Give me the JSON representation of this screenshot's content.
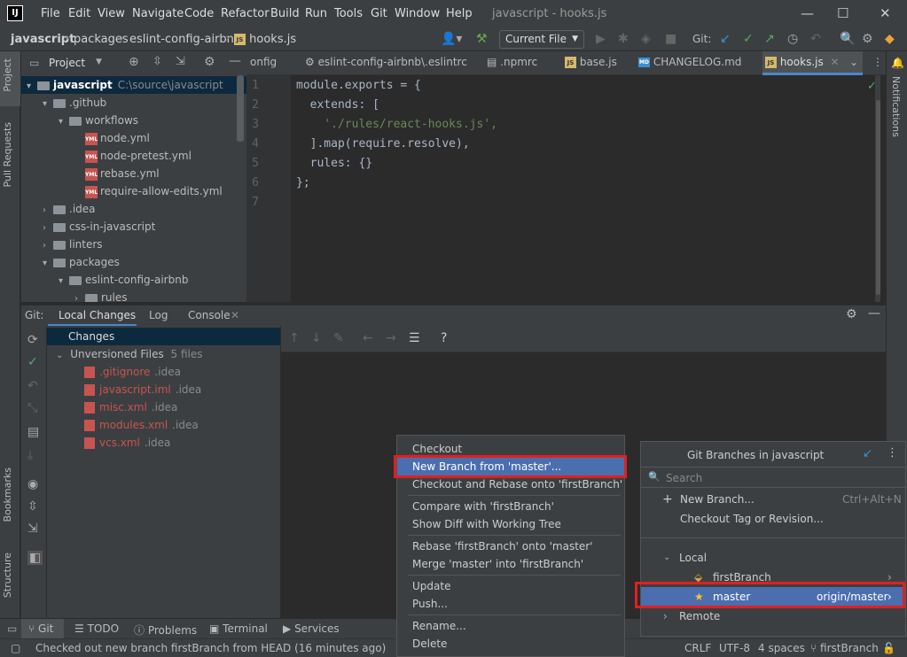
{
  "app": {
    "window_title": "javascript - hooks.js",
    "logo": "IJ"
  },
  "menu": [
    "File",
    "Edit",
    "View",
    "Navigate",
    "Code",
    "Refactor",
    "Build",
    "Run",
    "Tools",
    "Git",
    "Window",
    "Help"
  ],
  "breadcrumb": [
    "javascript",
    "packages",
    "eslint-config-airbnb",
    "hooks.js"
  ],
  "toolbar": {
    "run_config": "Current File",
    "git_label": "Git:"
  },
  "left_tools": {
    "project": "Project",
    "pull_requests": "Pull Requests",
    "bookmarks": "Bookmarks",
    "structure": "Structure"
  },
  "right_tools": {
    "notifications": "Notifications"
  },
  "project": {
    "header": "Project",
    "tree": [
      {
        "label": "javascript",
        "hint": "C:\\source\\javascript",
        "indent": 0,
        "arrow": "▾",
        "kind": "folder",
        "selected": true
      },
      {
        "label": ".github",
        "indent": 1,
        "arrow": "▾",
        "kind": "folder"
      },
      {
        "label": "workflows",
        "indent": 2,
        "arrow": "▾",
        "kind": "folder"
      },
      {
        "label": "node.yml",
        "indent": 3,
        "arrow": "",
        "kind": "yml"
      },
      {
        "label": "node-pretest.yml",
        "indent": 3,
        "arrow": "",
        "kind": "yml"
      },
      {
        "label": "rebase.yml",
        "indent": 3,
        "arrow": "",
        "kind": "yml"
      },
      {
        "label": "require-allow-edits.yml",
        "indent": 3,
        "arrow": "",
        "kind": "yml"
      },
      {
        "label": ".idea",
        "indent": 1,
        "arrow": "›",
        "kind": "folder"
      },
      {
        "label": "css-in-javascript",
        "indent": 1,
        "arrow": "›",
        "kind": "folder"
      },
      {
        "label": "linters",
        "indent": 1,
        "arrow": "›",
        "kind": "folder"
      },
      {
        "label": "packages",
        "indent": 1,
        "arrow": "▾",
        "kind": "folder"
      },
      {
        "label": "eslint-config-airbnb",
        "indent": 2,
        "arrow": "▾",
        "kind": "folder"
      },
      {
        "label": "rules",
        "indent": 3,
        "arrow": "›",
        "kind": "folder"
      }
    ]
  },
  "editor_tabs": [
    "onfig",
    "eslint-config-airbnb\\.eslintrc",
    ".npmrc",
    "base.js",
    "CHANGELOG.md",
    "hooks.js"
  ],
  "editor": {
    "lines": [
      "module.exports = {",
      "  extends: [",
      "    './rules/react-hooks.js',",
      "  ].map(require.resolve),",
      "  rules: {}",
      "};",
      ""
    ],
    "line_numbers": [
      "1",
      "2",
      "3",
      "4",
      "5",
      "6",
      "7"
    ]
  },
  "git_window": {
    "label": "Git:",
    "tabs": [
      "Local Changes",
      "Log",
      "Console"
    ],
    "changes_header": "Changes",
    "unversioned": "Unversioned Files",
    "unversioned_count": "5 files",
    "files": [
      {
        "name": ".gitignore",
        "dir": ".idea"
      },
      {
        "name": "javascript.iml",
        "dir": ".idea"
      },
      {
        "name": "misc.xml",
        "dir": ".idea"
      },
      {
        "name": "modules.xml",
        "dir": ".idea"
      },
      {
        "name": "vcs.xml",
        "dir": ".idea"
      }
    ]
  },
  "bottom_tabs": [
    "Git",
    "TODO",
    "Problems",
    "Terminal",
    "Services"
  ],
  "status": {
    "message": "Checked out new branch firstBranch from HEAD (16 minutes ago)",
    "line_sep": "CRLF",
    "encoding": "UTF-8",
    "indent": "4 spaces",
    "branch": "firstBranch"
  },
  "context_menu": {
    "groups": [
      [
        "Checkout",
        "New Branch from 'master'...",
        "Checkout and Rebase onto 'firstBranch'"
      ],
      [
        "Compare with 'firstBranch'",
        "Show Diff with Working Tree"
      ],
      [
        "Rebase 'firstBranch' onto 'master'",
        "Merge 'master' into 'firstBranch'"
      ],
      [
        "Update",
        "Push..."
      ],
      [
        "Rename...",
        "Delete"
      ]
    ],
    "highlighted": "New Branch from 'master'..."
  },
  "branches_popup": {
    "title": "Git Branches in javascript",
    "search_placeholder": "Search",
    "new_branch": "New Branch...",
    "new_branch_shortcut": "Ctrl+Alt+N",
    "checkout_tag": "Checkout Tag or Revision...",
    "local_header": "Local",
    "local": [
      {
        "name": "firstBranch",
        "tracking": ""
      },
      {
        "name": "master",
        "tracking": "origin/master"
      }
    ],
    "remote_header": "Remote"
  },
  "colors": {
    "accent": "#4b6eaf",
    "highlight_box": "#e0201f",
    "unversioned": "#c75450"
  }
}
